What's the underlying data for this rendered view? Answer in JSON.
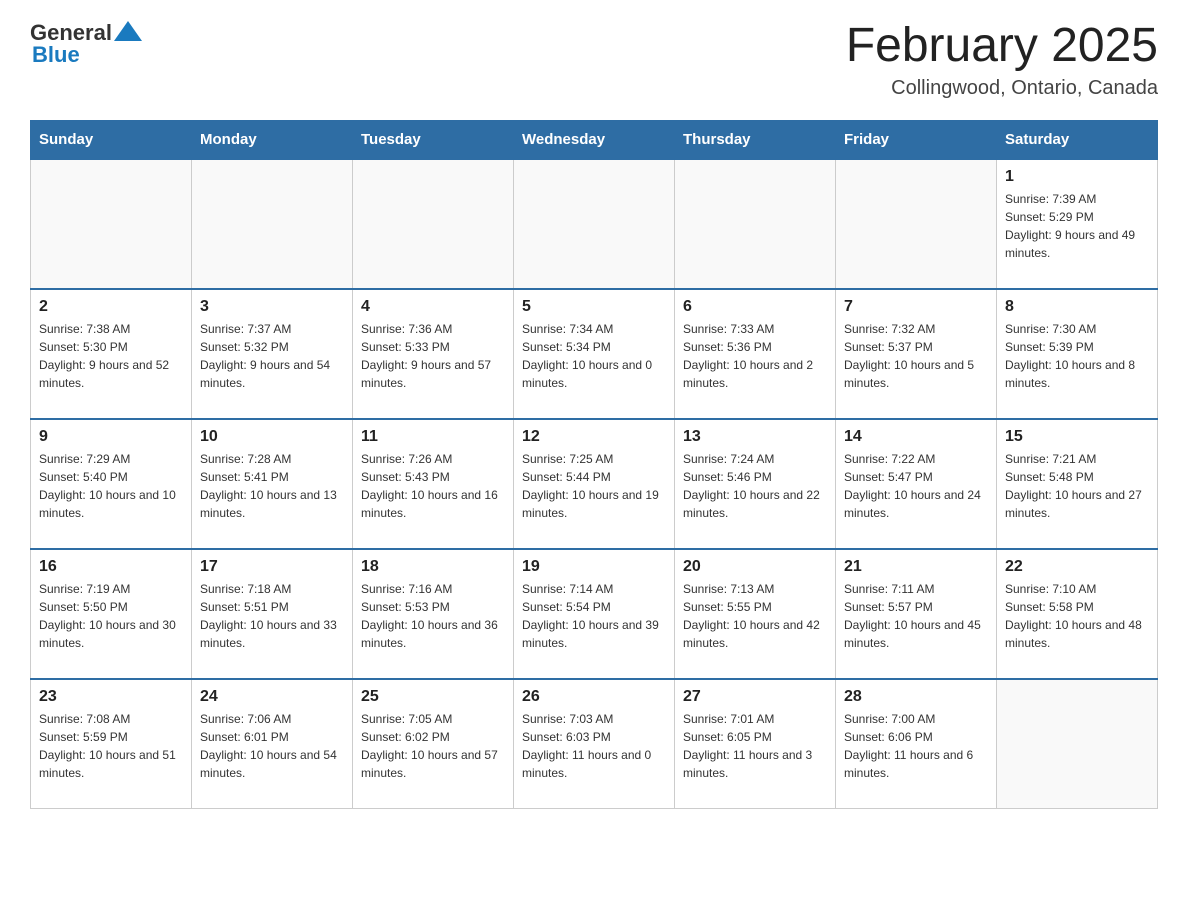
{
  "header": {
    "logo_general": "General",
    "logo_blue": "Blue",
    "month_title": "February 2025",
    "location": "Collingwood, Ontario, Canada"
  },
  "days_of_week": [
    "Sunday",
    "Monday",
    "Tuesday",
    "Wednesday",
    "Thursday",
    "Friday",
    "Saturday"
  ],
  "weeks": [
    [
      {
        "day": "",
        "info": ""
      },
      {
        "day": "",
        "info": ""
      },
      {
        "day": "",
        "info": ""
      },
      {
        "day": "",
        "info": ""
      },
      {
        "day": "",
        "info": ""
      },
      {
        "day": "",
        "info": ""
      },
      {
        "day": "1",
        "info": "Sunrise: 7:39 AM\nSunset: 5:29 PM\nDaylight: 9 hours and 49 minutes."
      }
    ],
    [
      {
        "day": "2",
        "info": "Sunrise: 7:38 AM\nSunset: 5:30 PM\nDaylight: 9 hours and 52 minutes."
      },
      {
        "day": "3",
        "info": "Sunrise: 7:37 AM\nSunset: 5:32 PM\nDaylight: 9 hours and 54 minutes."
      },
      {
        "day": "4",
        "info": "Sunrise: 7:36 AM\nSunset: 5:33 PM\nDaylight: 9 hours and 57 minutes."
      },
      {
        "day": "5",
        "info": "Sunrise: 7:34 AM\nSunset: 5:34 PM\nDaylight: 10 hours and 0 minutes."
      },
      {
        "day": "6",
        "info": "Sunrise: 7:33 AM\nSunset: 5:36 PM\nDaylight: 10 hours and 2 minutes."
      },
      {
        "day": "7",
        "info": "Sunrise: 7:32 AM\nSunset: 5:37 PM\nDaylight: 10 hours and 5 minutes."
      },
      {
        "day": "8",
        "info": "Sunrise: 7:30 AM\nSunset: 5:39 PM\nDaylight: 10 hours and 8 minutes."
      }
    ],
    [
      {
        "day": "9",
        "info": "Sunrise: 7:29 AM\nSunset: 5:40 PM\nDaylight: 10 hours and 10 minutes."
      },
      {
        "day": "10",
        "info": "Sunrise: 7:28 AM\nSunset: 5:41 PM\nDaylight: 10 hours and 13 minutes."
      },
      {
        "day": "11",
        "info": "Sunrise: 7:26 AM\nSunset: 5:43 PM\nDaylight: 10 hours and 16 minutes."
      },
      {
        "day": "12",
        "info": "Sunrise: 7:25 AM\nSunset: 5:44 PM\nDaylight: 10 hours and 19 minutes."
      },
      {
        "day": "13",
        "info": "Sunrise: 7:24 AM\nSunset: 5:46 PM\nDaylight: 10 hours and 22 minutes."
      },
      {
        "day": "14",
        "info": "Sunrise: 7:22 AM\nSunset: 5:47 PM\nDaylight: 10 hours and 24 minutes."
      },
      {
        "day": "15",
        "info": "Sunrise: 7:21 AM\nSunset: 5:48 PM\nDaylight: 10 hours and 27 minutes."
      }
    ],
    [
      {
        "day": "16",
        "info": "Sunrise: 7:19 AM\nSunset: 5:50 PM\nDaylight: 10 hours and 30 minutes."
      },
      {
        "day": "17",
        "info": "Sunrise: 7:18 AM\nSunset: 5:51 PM\nDaylight: 10 hours and 33 minutes."
      },
      {
        "day": "18",
        "info": "Sunrise: 7:16 AM\nSunset: 5:53 PM\nDaylight: 10 hours and 36 minutes."
      },
      {
        "day": "19",
        "info": "Sunrise: 7:14 AM\nSunset: 5:54 PM\nDaylight: 10 hours and 39 minutes."
      },
      {
        "day": "20",
        "info": "Sunrise: 7:13 AM\nSunset: 5:55 PM\nDaylight: 10 hours and 42 minutes."
      },
      {
        "day": "21",
        "info": "Sunrise: 7:11 AM\nSunset: 5:57 PM\nDaylight: 10 hours and 45 minutes."
      },
      {
        "day": "22",
        "info": "Sunrise: 7:10 AM\nSunset: 5:58 PM\nDaylight: 10 hours and 48 minutes."
      }
    ],
    [
      {
        "day": "23",
        "info": "Sunrise: 7:08 AM\nSunset: 5:59 PM\nDaylight: 10 hours and 51 minutes."
      },
      {
        "day": "24",
        "info": "Sunrise: 7:06 AM\nSunset: 6:01 PM\nDaylight: 10 hours and 54 minutes."
      },
      {
        "day": "25",
        "info": "Sunrise: 7:05 AM\nSunset: 6:02 PM\nDaylight: 10 hours and 57 minutes."
      },
      {
        "day": "26",
        "info": "Sunrise: 7:03 AM\nSunset: 6:03 PM\nDaylight: 11 hours and 0 minutes."
      },
      {
        "day": "27",
        "info": "Sunrise: 7:01 AM\nSunset: 6:05 PM\nDaylight: 11 hours and 3 minutes."
      },
      {
        "day": "28",
        "info": "Sunrise: 7:00 AM\nSunset: 6:06 PM\nDaylight: 11 hours and 6 minutes."
      },
      {
        "day": "",
        "info": ""
      }
    ]
  ]
}
